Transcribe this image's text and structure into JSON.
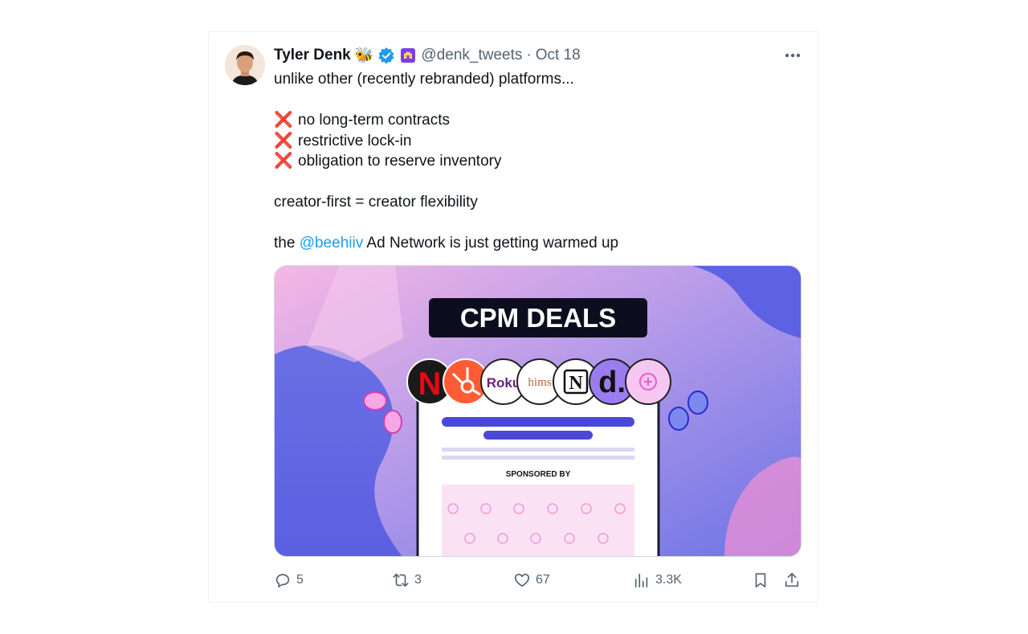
{
  "tweet": {
    "author": {
      "name": "Tyler Denk",
      "emoji": "🐝",
      "handle": "@denk_tweets",
      "separator": "·",
      "date": "Oct 18",
      "verified_color": "#1d9bf0"
    },
    "text": {
      "line1": "unlike other (recently rebranded) platforms...",
      "bullets": [
        {
          "mark": "❌",
          "text": "no long-term contracts"
        },
        {
          "mark": "❌",
          "text": "restrictive lock-in"
        },
        {
          "mark": "❌",
          "text": "obligation to reserve inventory"
        }
      ],
      "line2": "creator-first = creator flexibility",
      "line3_prefix": "the ",
      "mention": "@beehiiv",
      "line3_suffix": " Ad Network is just getting warmed up"
    },
    "media": {
      "banner_text": "CPM DEALS",
      "sponsored_label": "SPONSORED BY",
      "logos": [
        "N",
        "Roku",
        "hims",
        "N",
        "d."
      ]
    },
    "actions": {
      "replies": "5",
      "retweets": "3",
      "likes": "67",
      "views": "3.3K"
    },
    "icons": [
      "more-icon",
      "verified-icon",
      "affiliate-badge-icon",
      "reply-icon",
      "retweet-icon",
      "like-icon",
      "views-icon",
      "bookmark-icon",
      "share-icon"
    ],
    "colors": {
      "text": "#0f1419",
      "muted": "#536471",
      "link": "#1d9bf0",
      "x_mark": "#dd2e44"
    }
  }
}
